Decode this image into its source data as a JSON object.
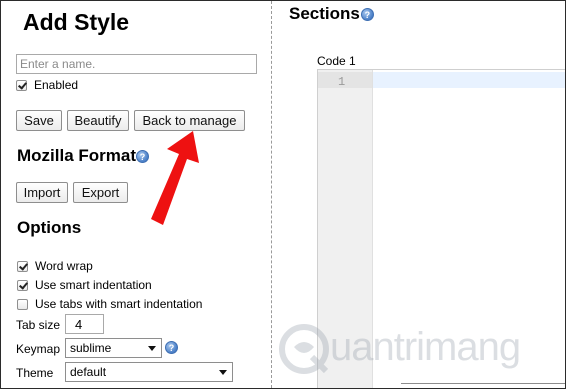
{
  "left_panel": {
    "title": "Add Style",
    "name_placeholder": "Enter a name.",
    "enabled_label": "Enabled",
    "buttons": {
      "save": "Save",
      "beautify": "Beautify",
      "back_to_manage": "Back to manage"
    },
    "mozilla_format": {
      "heading": "Mozilla Format",
      "import": "Import",
      "export": "Export"
    },
    "options": {
      "heading": "Options",
      "word_wrap": "Word wrap",
      "smart_indentation": "Use smart indentation",
      "tabs_smart_indentation": "Use tabs with smart indentation",
      "tab_size_label": "Tab size",
      "tab_size_value": "4",
      "keymap_label": "Keymap",
      "keymap_value": "sublime",
      "theme_label": "Theme",
      "theme_value": "default"
    }
  },
  "right_panel": {
    "sections_title": "Sections",
    "code_label": "Code 1",
    "line_number": "1"
  },
  "watermark": {
    "text": "uantrimang"
  },
  "colors": {
    "annotation_arrow": "#ee1111",
    "help_icon": "#4a7fc7",
    "active_line": "#e8f2ff"
  },
  "icons": {
    "help": "question-mark-circle-icon"
  }
}
